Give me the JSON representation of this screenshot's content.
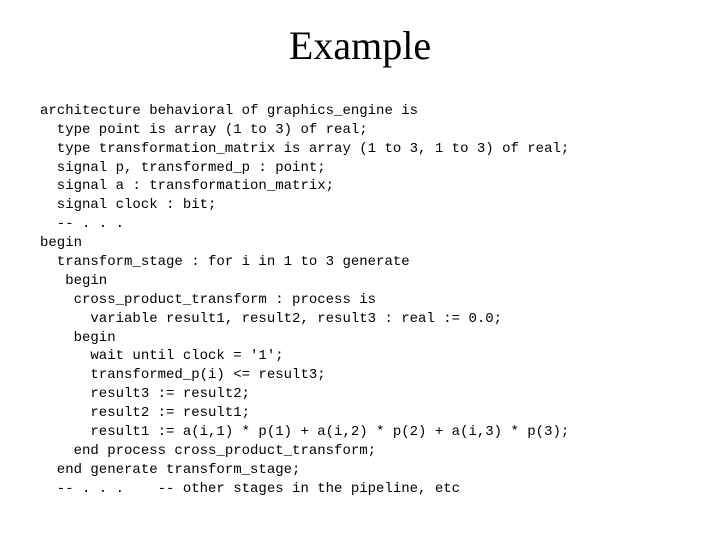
{
  "title": "Example",
  "code": {
    "l01": "architecture behavioral of graphics_engine is",
    "l02": "  type point is array (1 to 3) of real;",
    "l03": "  type transformation_matrix is array (1 to 3, 1 to 3) of real;",
    "l04": "  signal p, transformed_p : point;",
    "l05": "  signal a : transformation_matrix;",
    "l06": "  signal clock : bit;",
    "l07": "  -- . . .",
    "l08": "begin",
    "l09": "  transform_stage : for i in 1 to 3 generate",
    "l10": "   begin",
    "l11": "    cross_product_transform : process is",
    "l12": "      variable result1, result2, result3 : real := 0.0;",
    "l13": "    begin",
    "l14": "      wait until clock = '1';",
    "l15": "      transformed_p(i) <= result3;",
    "l16": "      result3 := result2;",
    "l17": "      result2 := result1;",
    "l18": "      result1 := a(i,1) * p(1) + a(i,2) * p(2) + a(i,3) * p(3);",
    "l19": "    end process cross_product_transform;",
    "l20": "  end generate transform_stage;",
    "l21": "  -- . . .    -- other stages in the pipeline, etc"
  }
}
